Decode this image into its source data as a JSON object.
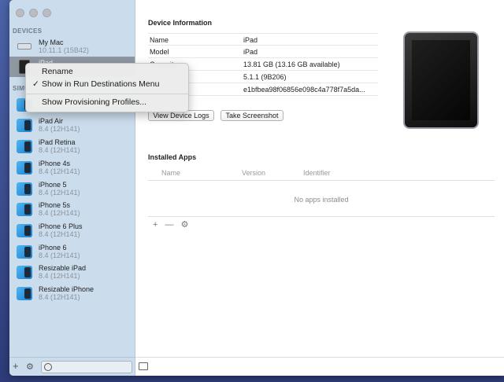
{
  "sidebar": {
    "devices_label": "DEVICES",
    "simulators_label": "SIMU",
    "devices": [
      {
        "name": "My Mac",
        "detail": "10.11.1 (15B42)"
      },
      {
        "name": "iPad",
        "detail": ""
      }
    ],
    "simulators": [
      {
        "name": "iPad Air",
        "detail": "8.4 (12H141)"
      },
      {
        "name": "iPad Retina",
        "detail": "8.4 (12H141)"
      },
      {
        "name": "iPhone 4s",
        "detail": "8.4 (12H141)"
      },
      {
        "name": "iPhone 5",
        "detail": "8.4 (12H141)"
      },
      {
        "name": "iPhone 5s",
        "detail": "8.4 (12H141)"
      },
      {
        "name": "iPhone 6 Plus",
        "detail": "8.4 (12H141)"
      },
      {
        "name": "iPhone 6",
        "detail": "8.4 (12H141)"
      },
      {
        "name": "Resizable iPad",
        "detail": "8.4 (12H141)"
      },
      {
        "name": "Resizable iPhone",
        "detail": "8.4 (12H141)"
      }
    ],
    "footer": {
      "add": "+",
      "gear": "⚙"
    }
  },
  "device_info": {
    "title": "Device Information",
    "rows": [
      {
        "key": "Name",
        "value": "iPad"
      },
      {
        "key": "Model",
        "value": "iPad"
      },
      {
        "key": "Capacity",
        "value": "13.81 GB (13.16 GB available)"
      },
      {
        "key": "",
        "value": "5.1.1 (9B206)"
      },
      {
        "key": "",
        "value": "e1bfbea98f06856e098c4a778f7a5da..."
      }
    ],
    "view_logs_label": "View Device Logs",
    "screenshot_label": "Take Screenshot"
  },
  "installed_apps": {
    "title": "Installed Apps",
    "columns": [
      "Name",
      "Version",
      "Identifier"
    ],
    "empty_text": "No apps installed",
    "add": "+",
    "remove": "—",
    "settings": "⚙"
  },
  "context_menu": {
    "items": [
      {
        "label": "Rename",
        "checked": ""
      },
      {
        "label": "Show in Run Destinations Menu",
        "checked": "✓"
      },
      {
        "label": "Show Provisioning Profiles...",
        "checked": ""
      }
    ]
  }
}
